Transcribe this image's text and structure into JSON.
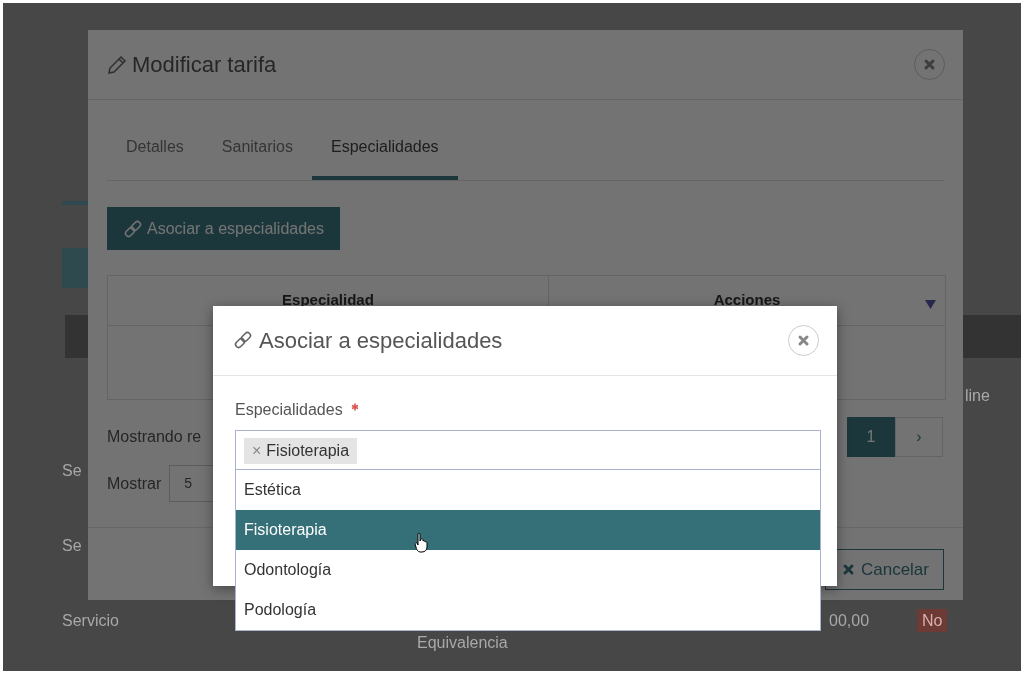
{
  "background_page": {
    "header_text": "line",
    "rows": [
      {
        "cells": [
          {
            "kind": "text",
            "text": "Se"
          }
        ]
      },
      {
        "cells": [
          {
            "kind": "text",
            "text": "Se"
          }
        ]
      },
      {
        "cells": [
          {
            "kind": "text",
            "text": "Servicio"
          },
          {
            "kind": "text",
            "text": "Equivalencia"
          },
          {
            "kind": "text",
            "text": "00,00"
          },
          {
            "kind": "badge",
            "text": "No"
          }
        ]
      }
    ]
  },
  "edit_dialog": {
    "title": "Modificar tarifa",
    "tabs": [
      {
        "label": "Detalles",
        "selected": false
      },
      {
        "label": "Sanitarios",
        "selected": false
      },
      {
        "label": "Especialidades",
        "selected": true
      }
    ],
    "associate_button": "Asociar a especialidades",
    "table": {
      "columns": [
        "Especialidad",
        "Acciones"
      ]
    },
    "showing_text": "Mostrando re",
    "pagination": [
      {
        "label": "1",
        "selected": true
      },
      {
        "label": "›",
        "selected": false
      }
    ],
    "page_size_label": "Mostrar",
    "page_size": "5",
    "cancel_button": "Cancelar"
  },
  "associate_dialog": {
    "title": "Asociar a especialidades",
    "field_label": "Especialidades",
    "required": true,
    "tags": [
      {
        "remove": "×",
        "label": "Fisioterapia"
      }
    ],
    "options": [
      {
        "label": "Estética",
        "selected": false
      },
      {
        "label": "Fisioterapia",
        "selected": true
      },
      {
        "label": "Odontología",
        "selected": false
      },
      {
        "label": "Podología",
        "selected": false
      }
    ]
  }
}
